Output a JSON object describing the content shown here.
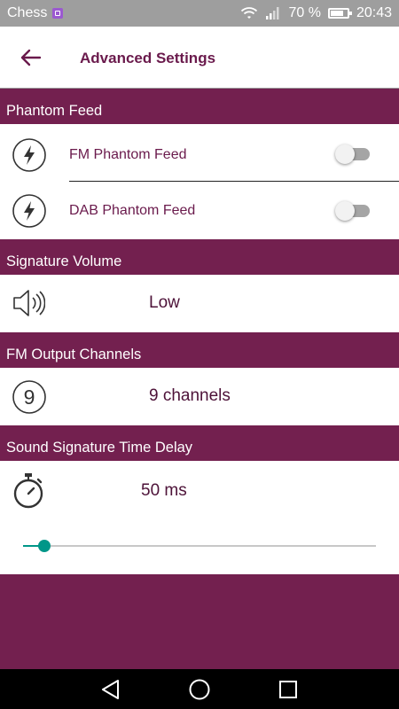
{
  "status_bar": {
    "app_name": "Chess",
    "battery": "70 %",
    "time": "20:43",
    "icons": [
      "wifi-icon",
      "signal-icon",
      "battery-icon"
    ]
  },
  "app_bar": {
    "title": "Advanced Settings",
    "back_icon": "arrow-left-icon"
  },
  "phantom_feed": {
    "header": "Phantom Feed",
    "items": [
      {
        "label": "FM Phantom Feed",
        "icon": "lightning-icon",
        "enabled": false
      },
      {
        "label": "DAB Phantom Feed",
        "icon": "lightning-icon",
        "enabled": false
      }
    ]
  },
  "signature_volume": {
    "header": "Signature Volume",
    "icon": "speaker-icon",
    "value": "Low"
  },
  "fm_output_channels": {
    "header": "FM Output Channels",
    "icon": "number-nine-icon",
    "icon_text": "9",
    "value": "9 channels"
  },
  "time_delay": {
    "header": "Sound Signature Time Delay",
    "icon": "stopwatch-icon",
    "value": "50 ms",
    "slider_fraction": 0.06
  },
  "colors": {
    "primary": "#73204f",
    "accent": "#009688",
    "text": "#6a1a4c"
  },
  "nav_bar": {
    "buttons": [
      "back-triangle-icon",
      "home-circle-icon",
      "recents-square-icon"
    ]
  }
}
